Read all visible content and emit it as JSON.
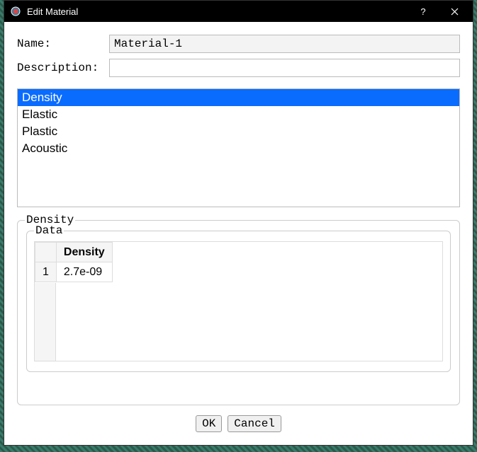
{
  "titlebar": {
    "title": "Edit Material",
    "help": "?",
    "close": "×"
  },
  "form": {
    "name_label": "Name:",
    "name_value": "Material-1",
    "desc_label": "Description:",
    "desc_value": ""
  },
  "behaviors": [
    {
      "label": "Density",
      "selected": true
    },
    {
      "label": "Elastic",
      "selected": false
    },
    {
      "label": "Plastic",
      "selected": false
    },
    {
      "label": "Acoustic",
      "selected": false
    }
  ],
  "group": {
    "outer_label": "Density",
    "inner_label": "Data",
    "table": {
      "header": "Density",
      "rows": [
        {
          "index": "1",
          "value": "2.7e-09"
        }
      ]
    }
  },
  "buttons": {
    "ok": "OK",
    "cancel": "Cancel"
  }
}
